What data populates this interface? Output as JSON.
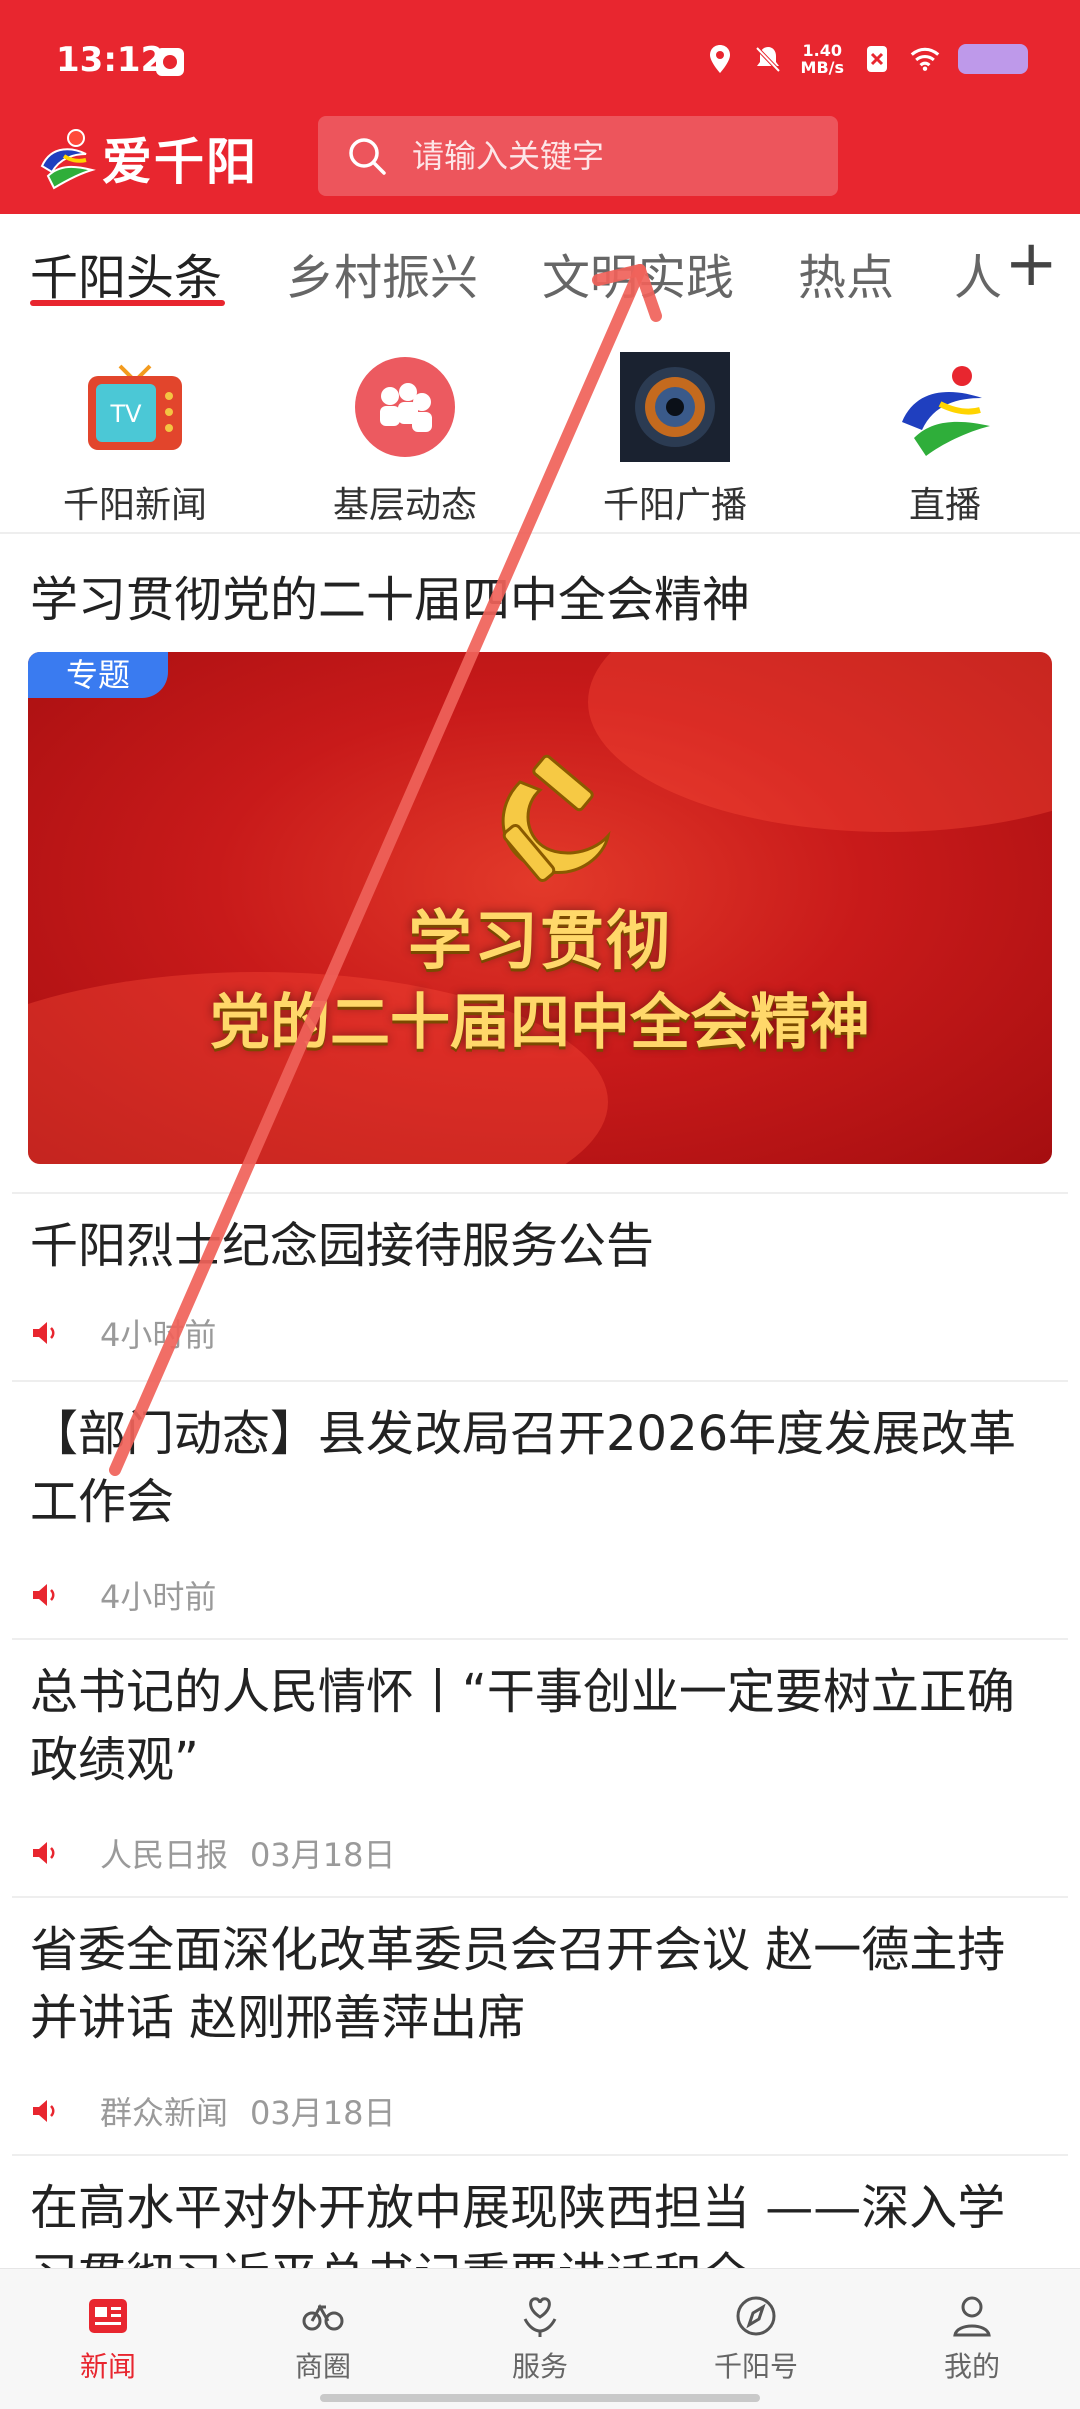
{
  "status_bar": {
    "time": "13:12",
    "speed_value": "1.40",
    "speed_unit": "MB/s"
  },
  "app": {
    "title": "爱千阳"
  },
  "search": {
    "placeholder": "请输入关键字"
  },
  "tabs": [
    {
      "label": "千阳头条",
      "active": true
    },
    {
      "label": "乡村振兴"
    },
    {
      "label": "文明实践"
    },
    {
      "label": "热点"
    },
    {
      "label": "人"
    }
  ],
  "quick_links": [
    {
      "label": "千阳新闻",
      "icon": "tv-icon"
    },
    {
      "label": "基层动态",
      "icon": "people-icon"
    },
    {
      "label": "千阳广播",
      "icon": "camera-lens-icon"
    },
    {
      "label": "直播",
      "icon": "logo-icon"
    }
  ],
  "feature": {
    "title": "学习贯彻党的二十届四中全会精神",
    "badge": "专题",
    "banner_line1": "学习贯彻",
    "banner_line2": "党的二十届四中全会精神"
  },
  "news": [
    {
      "title": "千阳烈士纪念园接待服务公告",
      "source": "",
      "time": "4小时前"
    },
    {
      "title": "【部门动态】县发改局召开2026年度发展改革工作会",
      "source": "",
      "time": "4小时前"
    },
    {
      "title": "总书记的人民情怀丨“干事创业一定要树立正确政绩观”",
      "source": "人民日报",
      "time": "03月18日"
    },
    {
      "title": "省委全面深化改革委员会召开会议 赵一德主持并讲话 赵刚邢善萍出席",
      "source": "群众新闻",
      "time": "03月18日"
    },
    {
      "title": "在高水平对外开放中展现陕西担当 ——深入学习贯彻习近平总书记重要讲话和全",
      "source": "",
      "time": ""
    }
  ],
  "bottom_nav": [
    {
      "label": "新闻",
      "active": true
    },
    {
      "label": "商圈"
    },
    {
      "label": "服务"
    },
    {
      "label": "千阳号"
    },
    {
      "label": "我的"
    }
  ],
  "colors": {
    "brand_red": "#e8262f",
    "badge_blue": "#3a7bf0",
    "gesture_arrow": "#f0625a"
  }
}
